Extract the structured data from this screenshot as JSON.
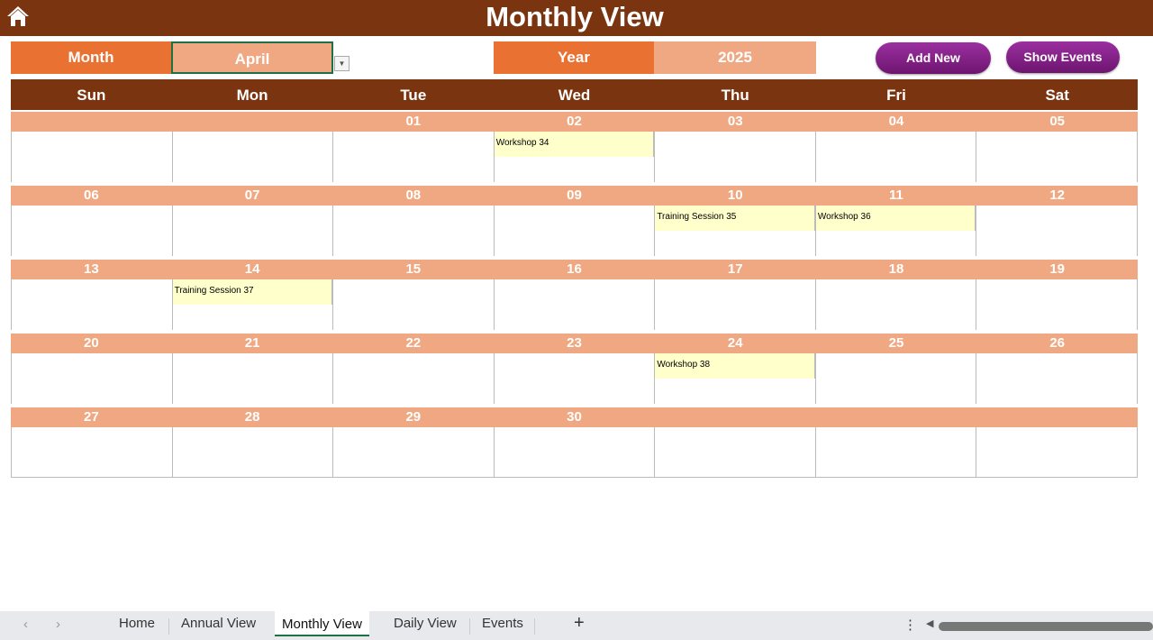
{
  "header": {
    "title": "Monthly View",
    "home_icon": "home-icon"
  },
  "controls": {
    "month_label": "Month",
    "month_value": "April",
    "year_label": "Year",
    "year_value": "2025",
    "add_new": "Add New",
    "show_events": "Show Events"
  },
  "colors": {
    "header": "#7B3410",
    "label": "#E97132",
    "value": "#F0A882",
    "event": "#FFFFCC",
    "button": "#8A2290"
  },
  "calendar": {
    "days": [
      "Sun",
      "Mon",
      "Tue",
      "Wed",
      "Thu",
      "Fri",
      "Sat"
    ],
    "weeks": [
      [
        {
          "date": "",
          "event": ""
        },
        {
          "date": "",
          "event": ""
        },
        {
          "date": "01",
          "event": ""
        },
        {
          "date": "02",
          "event": "Workshop 34"
        },
        {
          "date": "03",
          "event": ""
        },
        {
          "date": "04",
          "event": ""
        },
        {
          "date": "05",
          "event": ""
        }
      ],
      [
        {
          "date": "06",
          "event": ""
        },
        {
          "date": "07",
          "event": ""
        },
        {
          "date": "08",
          "event": ""
        },
        {
          "date": "09",
          "event": ""
        },
        {
          "date": "10",
          "event": "Training Session 35"
        },
        {
          "date": "11",
          "event": "Workshop 36"
        },
        {
          "date": "12",
          "event": ""
        }
      ],
      [
        {
          "date": "13",
          "event": ""
        },
        {
          "date": "14",
          "event": "Training Session 37"
        },
        {
          "date": "15",
          "event": ""
        },
        {
          "date": "16",
          "event": ""
        },
        {
          "date": "17",
          "event": ""
        },
        {
          "date": "18",
          "event": ""
        },
        {
          "date": "19",
          "event": ""
        }
      ],
      [
        {
          "date": "20",
          "event": ""
        },
        {
          "date": "21",
          "event": ""
        },
        {
          "date": "22",
          "event": ""
        },
        {
          "date": "23",
          "event": ""
        },
        {
          "date": "24",
          "event": "Workshop 38"
        },
        {
          "date": "25",
          "event": ""
        },
        {
          "date": "26",
          "event": ""
        }
      ],
      [
        {
          "date": "27",
          "event": ""
        },
        {
          "date": "28",
          "event": ""
        },
        {
          "date": "29",
          "event": ""
        },
        {
          "date": "30",
          "event": ""
        },
        {
          "date": "",
          "event": ""
        },
        {
          "date": "",
          "event": ""
        },
        {
          "date": "",
          "event": ""
        }
      ]
    ]
  },
  "sheet_tabs": {
    "tabs": [
      "Home",
      "Annual View",
      "Monthly View",
      "Daily View",
      "Events"
    ],
    "active": "Monthly View",
    "add": "+"
  }
}
